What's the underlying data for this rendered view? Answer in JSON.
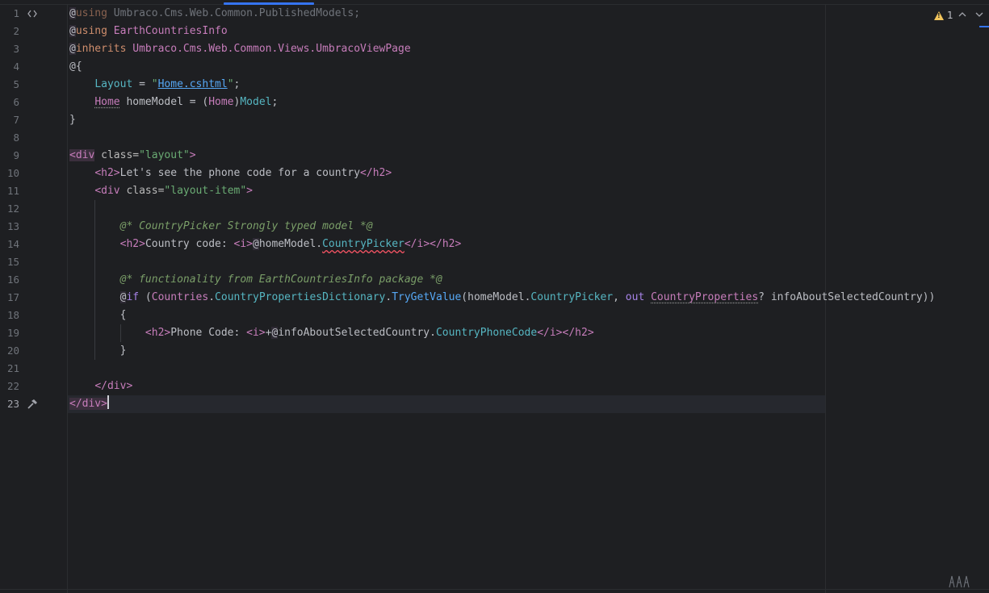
{
  "editor": {
    "warnings": {
      "count": "1"
    },
    "gutter_icons": {
      "line1": "code-icon",
      "line23": "hammer-icon"
    },
    "lines": [
      {
        "n": "1"
      },
      {
        "n": "2"
      },
      {
        "n": "3"
      },
      {
        "n": "4"
      },
      {
        "n": "5"
      },
      {
        "n": "6"
      },
      {
        "n": "7"
      },
      {
        "n": "8"
      },
      {
        "n": "9"
      },
      {
        "n": "10"
      },
      {
        "n": "11"
      },
      {
        "n": "12"
      },
      {
        "n": "13"
      },
      {
        "n": "14"
      },
      {
        "n": "15"
      },
      {
        "n": "16"
      },
      {
        "n": "17"
      },
      {
        "n": "18"
      },
      {
        "n": "19"
      },
      {
        "n": "20"
      },
      {
        "n": "21"
      },
      {
        "n": "22"
      },
      {
        "n": "23"
      }
    ],
    "code": {
      "l1": {
        "at": "@",
        "kw": "using",
        "ns": " Umbraco.Cms.Web.Common.PublishedModels;"
      },
      "l2": {
        "at": "@",
        "kw": "using",
        "ns": " EarthCountriesInfo"
      },
      "l3": {
        "at": "@",
        "kw": "inherits",
        "ns": " Umbraco.Cms.Web.Common.Views.UmbracoViewPage"
      },
      "l4": {
        "t": "@{"
      },
      "l5": {
        "indent": "    ",
        "prop": "Layout",
        "eq": " = ",
        "q1": "\"",
        "val": "Home.cshtml",
        "q2": "\"",
        "end": ";"
      },
      "l6": {
        "indent": "    ",
        "cls": "Home",
        "mid": " homeModel = (",
        "cls2": "Home",
        ")": ")",
        "fld": "Model",
        "end": ";"
      },
      "l7": {
        "t": "}"
      },
      "l9": {
        "open": "<div",
        "attr": " class=",
        "val": "\"layout\"",
        "close": ">"
      },
      "l10": {
        "indent": "    ",
        "open": "<h2>",
        "text": "Let's see the phone code for a country",
        "close": "</h2>"
      },
      "l11": {
        "indent": "    ",
        "open": "<div",
        "attr": " class=",
        "val": "\"layout-item\"",
        "close": ">"
      },
      "l13": {
        "indent": "        ",
        "cmt": "@* CountryPicker Strongly typed model *@"
      },
      "l14": {
        "indent": "        ",
        "open": "<h2>",
        "text": "Country code: ",
        "i": "<i>",
        "at": "@",
        "var": "homeModel.",
        "fld": "CountryPicker",
        "ci": "</i>",
        "close": "</h2>"
      },
      "l16": {
        "indent": "        ",
        "cmt": "@* functionality from EarthCountriesInfo package *@"
      },
      "l17": {
        "indent": "        ",
        "at": "@",
        "kw": "if",
        "p1": " (",
        "cls": "Countries",
        ".": ".",
        "fld": "CountryPropertiesDictionary",
        ".2": ".",
        "meth": "TryGetValue",
        "p2": "(homeModel.",
        "fld2": "CountryPicker",
        ", ": ", ",
        "out": "out",
        "sp": " ",
        "cls2": "CountryProperties",
        "rest": "? infoAboutSelectedCountry))"
      },
      "l18": {
        "indent": "        ",
        "t": "{"
      },
      "l19": {
        "indent": "            ",
        "open": "<h2>",
        "text": "Phone Code: ",
        "i": "<i>",
        "plus": "+",
        "at": "@",
        "var": "infoAboutSelectedCountry.",
        "fld": "CountryPhoneCode",
        "ci": "</i>",
        "close": "</h2>"
      },
      "l20": {
        "indent": "        ",
        "t": "}"
      },
      "l22": {
        "indent": "    ",
        "close": "</div>"
      },
      "l23": {
        "close": "</div>"
      }
    }
  }
}
